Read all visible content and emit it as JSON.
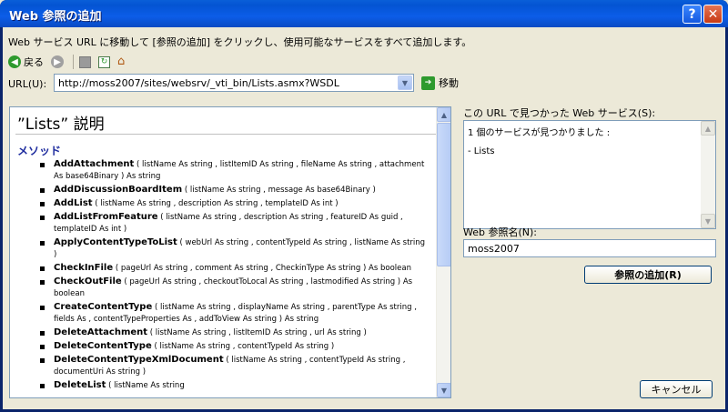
{
  "window": {
    "title": "Web 参照の追加",
    "help_label": "?",
    "close_label": "✕"
  },
  "instruction": "Web サービス URL に移動して [参照の追加] をクリックし、使用可能なサービスをすべて追加します。",
  "toolbar": {
    "back_label": "戻る"
  },
  "url": {
    "label": "URL(U):",
    "value": "http://moss2007/sites/websrv/_vti_bin/Lists.asmx?WSDL",
    "go_label": "移動"
  },
  "content": {
    "title": "”Lists” 説明",
    "methods_heading": "メソッド",
    "methods": [
      {
        "name": "AddAttachment",
        "params": "( listName As string , listItemID As string , fileName As string , attachment As base64Binary ) As string"
      },
      {
        "name": "AddDiscussionBoardItem",
        "params": "( listName As string , message As base64Binary )"
      },
      {
        "name": "AddList",
        "params": "( listName As string , description As string , templateID As int )"
      },
      {
        "name": "AddListFromFeature",
        "params": "( listName As string , description As string , featureID As guid , templateID As int )"
      },
      {
        "name": "ApplyContentTypeToList",
        "params": "( webUrl As string , contentTypeId As string , listName As string )"
      },
      {
        "name": "CheckInFile",
        "params": "( pageUrl As string , comment As string , CheckinType As string ) As boolean"
      },
      {
        "name": "CheckOutFile",
        "params": "( pageUrl As string , checkoutToLocal As string , lastmodified As string ) As boolean"
      },
      {
        "name": "CreateContentType",
        "params": "( listName As string , displayName As string , parentType As string , fields As , contentTypeProperties As , addToView As string ) As string"
      },
      {
        "name": "DeleteAttachment",
        "params": "( listName As string , listItemID As string , url As string )"
      },
      {
        "name": "DeleteContentType",
        "params": "( listName As string , contentTypeId As string )"
      },
      {
        "name": "DeleteContentTypeXmlDocument",
        "params": "( listName As string , contentTypeId As string , documentUri As string )"
      },
      {
        "name": "DeleteList",
        "params": "( listName As string"
      }
    ]
  },
  "services": {
    "label": "この URL で見つかった Web サービス(S):",
    "found_text": "1 個のサービスが見つかりました :",
    "items": [
      "- Lists"
    ]
  },
  "reference": {
    "label": "Web 参照名(N):",
    "value": "moss2007",
    "add_button": "参照の追加(R)"
  },
  "cancel_button": "キャンセル"
}
